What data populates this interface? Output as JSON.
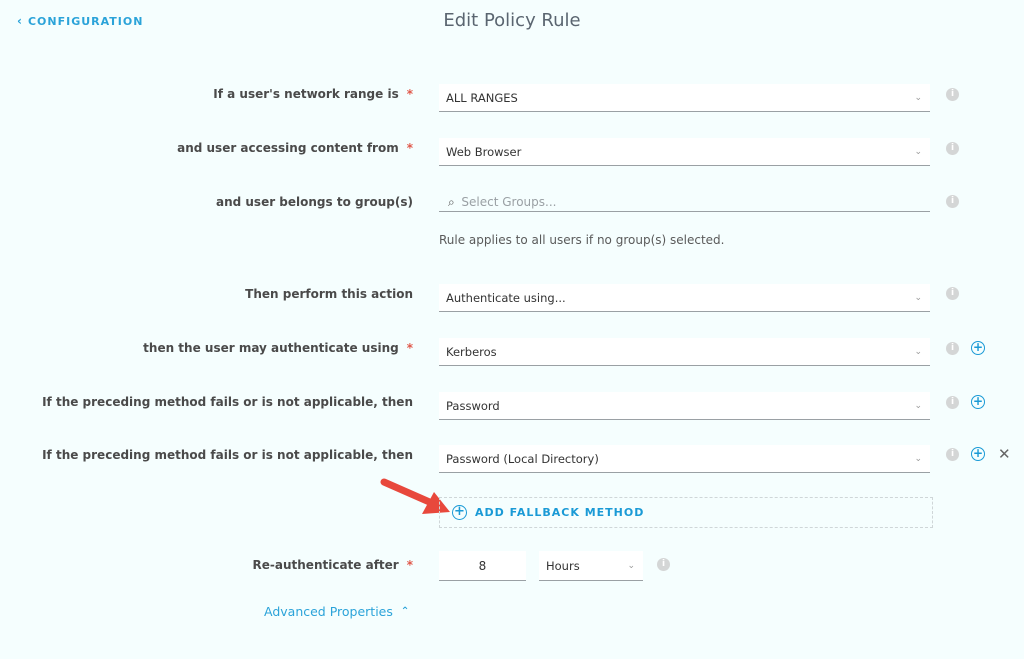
{
  "header": {
    "back_label": "CONFIGURATION",
    "back_icon": "chevron-left-icon",
    "title": "Edit Policy Rule"
  },
  "form": {
    "network_range": {
      "label": "If a user's network range is",
      "required": "*",
      "value": "ALL RANGES"
    },
    "access_from": {
      "label": "and user accessing content from",
      "required": "*",
      "value": "Web Browser"
    },
    "groups": {
      "label": "and user belongs to group(s)",
      "placeholder": "Select Groups...",
      "hint": "Rule applies to all users if no group(s) selected."
    },
    "action": {
      "label": "Then perform this action",
      "value": "Authenticate using..."
    },
    "auth_method": {
      "label": "then the user may authenticate using",
      "required": "*",
      "value": "Kerberos"
    },
    "fallback_1": {
      "label": "If the preceding method fails or is not applicable, then",
      "value": "Password"
    },
    "fallback_2": {
      "label": "If the preceding method fails or is not applicable, then",
      "value": "Password (Local Directory)"
    },
    "add_fallback_label": "ADD FALLBACK METHOD",
    "reauth": {
      "label": "Re-authenticate after",
      "required": "*",
      "value": "8",
      "unit": "Hours"
    },
    "advanced_label": "Advanced Properties"
  },
  "icons": {
    "info": "i",
    "plus": "+",
    "close": "✕",
    "caret": "⌄",
    "search": "🔍",
    "chevron_up": "⌃"
  },
  "colors": {
    "accent": "#1a9ad6",
    "required": "#e0584a",
    "background": "#f5fefe",
    "annotation_arrow": "#e8483c"
  }
}
